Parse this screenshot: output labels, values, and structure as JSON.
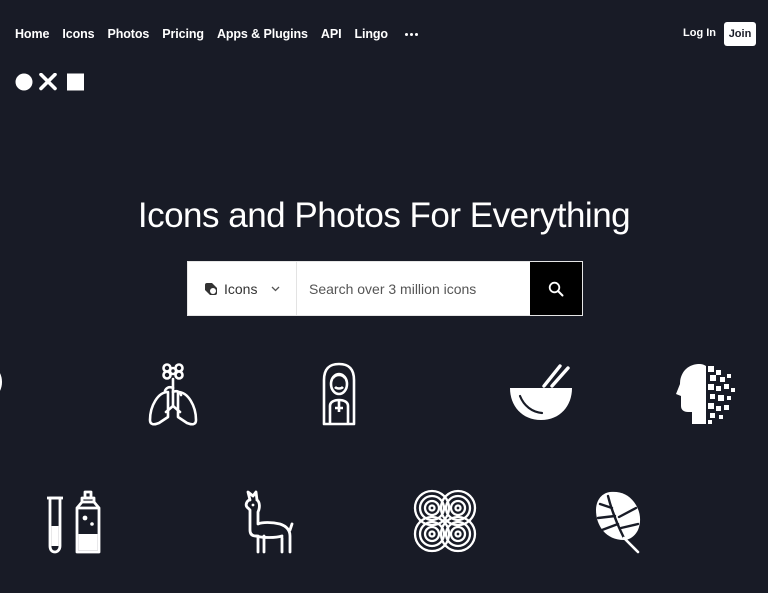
{
  "nav": {
    "links": [
      "Home",
      "Icons",
      "Photos",
      "Pricing",
      "Apps & Plugins",
      "API",
      "Lingo"
    ],
    "more_icon": "more-dots-icon",
    "login_label": "Log In",
    "join_label": "Join"
  },
  "logo": {
    "icon": "noun-project-logo"
  },
  "hero": {
    "title": "Icons and Photos For Everything"
  },
  "search": {
    "type_label": "Icons",
    "type_icon": "icons-type-icon",
    "placeholder": "Search over 3 million icons",
    "value": "",
    "button_icon": "search-icon"
  },
  "showcase": {
    "icons": [
      "partial-circle-icon",
      "lungs-flower-icon",
      "woman-portrait-icon",
      "bowl-chopsticks-icon",
      "pixel-head-icon",
      "lab-bottles-icon",
      "llama-icon",
      "knot-pattern-icon",
      "monstera-leaf-icon"
    ]
  },
  "colors": {
    "background": "#181b26",
    "foreground": "#ffffff",
    "search_button": "#000000"
  }
}
